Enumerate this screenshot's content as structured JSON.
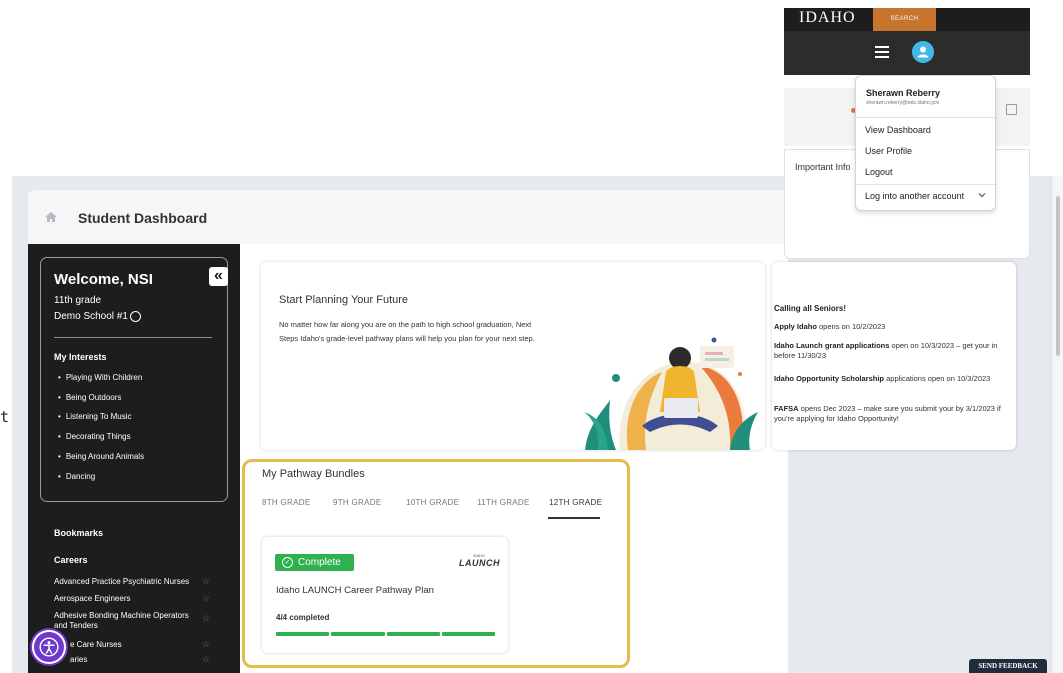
{
  "header": {
    "title": "Student Dashboard"
  },
  "sidebar": {
    "collapse_glyph": "«",
    "welcome": "Welcome, NSI",
    "grade": "11th grade",
    "school": "Demo School #1",
    "interests_title": "My Interests",
    "interests": [
      "Playing With Children",
      "Being Outdoors",
      "Listening To Music",
      "Decorating Things",
      "Being Around Animals",
      "Dancing"
    ],
    "bookmarks_title": "Bookmarks",
    "careers_title": "Careers",
    "careers": [
      "Advanced Practice Psychiatric Nurses",
      "Aerospace Engineers",
      "Adhesive Bonding Machine Operators and Tenders",
      "e Care Nurses",
      "aries"
    ]
  },
  "planning": {
    "title": "Start Planning Your Future",
    "body": "No matter how far along you are on the path to high school graduation, Next Steps Idaho's grade-level pathway plans will help you plan for your next step."
  },
  "news": {
    "heading": "Calling all Seniors!",
    "items": [
      {
        "bold": "Apply Idaho",
        "rest": " opens on 10/2/2023"
      },
      {
        "bold": "Idaho Launch grant applications",
        "rest": " open on 10/3/2023 – get your in before 11/30/23"
      },
      {
        "bold": "Idaho Opportunity Scholarship",
        "rest": " applications open on 10/3/2023"
      },
      {
        "bold": "FAFSA",
        "rest": " opens Dec 2023 – make sure you submit your by 3/1/2023 if you're applying for Idaho Opportunity!"
      }
    ]
  },
  "bundles": {
    "title": "My Pathway Bundles",
    "tabs": [
      "8TH GRADE",
      "9TH GRADE",
      "10TH GRADE",
      "11TH GRADE",
      "12TH GRADE"
    ],
    "active_tab": "12TH GRADE",
    "card": {
      "status": "Complete",
      "logo_small": "IDAHO",
      "logo_big": "LAUNCH",
      "name": "Idaho LAUNCH Career Pathway Plan",
      "progress_text": "4/4 completed",
      "steps_done": 4,
      "steps_total": 4
    }
  },
  "nav": {
    "logo": "IDAHO",
    "search": "SEARCH"
  },
  "info": {
    "label": "Important Info"
  },
  "user_menu": {
    "name": "Sherawn Reberry",
    "email": "sherawn.reberry@wdc.idaho.gov",
    "items": [
      "View Dashboard",
      "User Profile",
      "Logout"
    ],
    "switch_account": "Log into another account"
  },
  "feedback": "SEND FEEDBACK",
  "stray_text": "t",
  "colors": {
    "accent_green": "#2eb14e",
    "highlight_outline": "#e3bb4e",
    "search_orange": "#c7742e",
    "avatar_blue": "#43b7e8",
    "accessibility_purple": "#6f39c9"
  }
}
